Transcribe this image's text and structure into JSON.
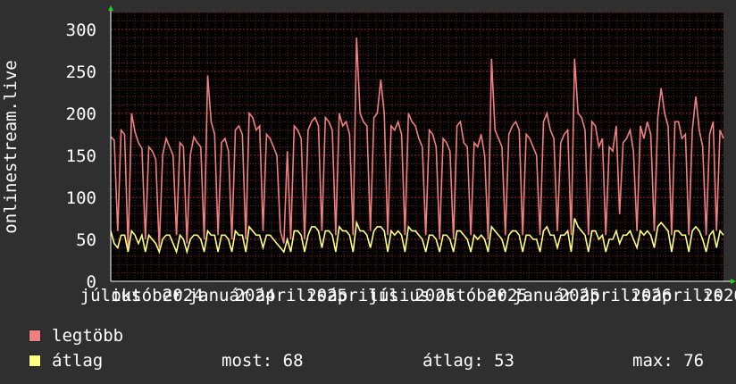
{
  "chart_data": {
    "type": "line",
    "ylabel": "onlinestream.live",
    "ylim": [
      0,
      320
    ],
    "yticks": [
      0,
      50,
      100,
      150,
      200,
      250,
      300
    ],
    "xtick_labels": [
      "július",
      "október",
      "2024",
      "január",
      "2024",
      "április",
      "2025",
      "április",
      "július",
      "2025",
      "október",
      "2025",
      "január",
      "2025",
      "április",
      "2026",
      "április",
      "2026"
    ],
    "grid": true,
    "background": "#000000",
    "grid_color": "#7a1f1f",
    "series": [
      {
        "name": "legtöbb",
        "color": "#f08080",
        "values": [
          172,
          168,
          60,
          180,
          175,
          40,
          200,
          178,
          165,
          158,
          50,
          160,
          155,
          145,
          40,
          150,
          170,
          160,
          150,
          55,
          165,
          160,
          45,
          150,
          172,
          165,
          160,
          50,
          245,
          190,
          175,
          55,
          165,
          170,
          155,
          50,
          180,
          185,
          175,
          50,
          200,
          195,
          180,
          185,
          60,
          175,
          170,
          160,
          150,
          60,
          45,
          155,
          50,
          185,
          180,
          170,
          50,
          180,
          190,
          195,
          185,
          60,
          195,
          190,
          180,
          55,
          200,
          185,
          190,
          175,
          55,
          290,
          200,
          190,
          185,
          60,
          195,
          200,
          240,
          200,
          55,
          185,
          180,
          190,
          175,
          55,
          200,
          190,
          185,
          170,
          160,
          55,
          180,
          175,
          160,
          50,
          170,
          165,
          155,
          50,
          185,
          190,
          165,
          160,
          55,
          165,
          160,
          175,
          150,
          50,
          265,
          180,
          170,
          160,
          55,
          175,
          185,
          190,
          180,
          55,
          175,
          170,
          160,
          150,
          55,
          190,
          200,
          180,
          170,
          60,
          165,
          175,
          180,
          55,
          265,
          200,
          195,
          180,
          55,
          190,
          185,
          160,
          170,
          55,
          160,
          155,
          185,
          80,
          165,
          170,
          180,
          155,
          60,
          185,
          170,
          190,
          175,
          60,
          195,
          230,
          200,
          185,
          55,
          190,
          190,
          170,
          175,
          55,
          180,
          220,
          180,
          160,
          55,
          175,
          190,
          60,
          180,
          170
        ],
        "tick_every": 1
      },
      {
        "name": "átlag",
        "color": "#ffff80",
        "values": [
          60,
          45,
          40,
          55,
          55,
          35,
          60,
          55,
          45,
          55,
          35,
          55,
          50,
          45,
          35,
          50,
          55,
          55,
          45,
          35,
          55,
          50,
          35,
          50,
          55,
          55,
          50,
          35,
          60,
          55,
          55,
          35,
          55,
          55,
          50,
          35,
          60,
          55,
          55,
          35,
          65,
          60,
          55,
          55,
          40,
          55,
          55,
          50,
          45,
          40,
          35,
          50,
          35,
          60,
          60,
          55,
          35,
          55,
          65,
          65,
          60,
          40,
          60,
          60,
          55,
          35,
          65,
          60,
          60,
          55,
          35,
          70,
          60,
          60,
          55,
          40,
          60,
          65,
          65,
          60,
          35,
          60,
          55,
          60,
          55,
          35,
          65,
          60,
          60,
          55,
          50,
          35,
          55,
          55,
          50,
          35,
          55,
          55,
          50,
          35,
          60,
          60,
          55,
          50,
          35,
          55,
          50,
          55,
          50,
          35,
          65,
          60,
          55,
          50,
          35,
          55,
          60,
          60,
          55,
          35,
          55,
          55,
          50,
          50,
          35,
          60,
          65,
          55,
          55,
          40,
          55,
          55,
          60,
          35,
          75,
          65,
          60,
          55,
          35,
          60,
          60,
          50,
          55,
          35,
          50,
          50,
          60,
          45,
          55,
          55,
          60,
          50,
          40,
          60,
          55,
          60,
          55,
          40,
          65,
          70,
          65,
          60,
          35,
          60,
          60,
          55,
          55,
          35,
          60,
          65,
          60,
          50,
          35,
          55,
          60,
          40,
          60,
          55
        ]
      }
    ]
  },
  "legend": {
    "items": [
      {
        "label": "legtöbb",
        "color": "#f08080"
      },
      {
        "label": "átlag",
        "color": "#ffff80"
      }
    ],
    "stats": {
      "now_label": "most:",
      "now_value": "68",
      "avg_label": "átlag:",
      "avg_value": "53",
      "max_label": "max:",
      "max_value": "76"
    }
  }
}
